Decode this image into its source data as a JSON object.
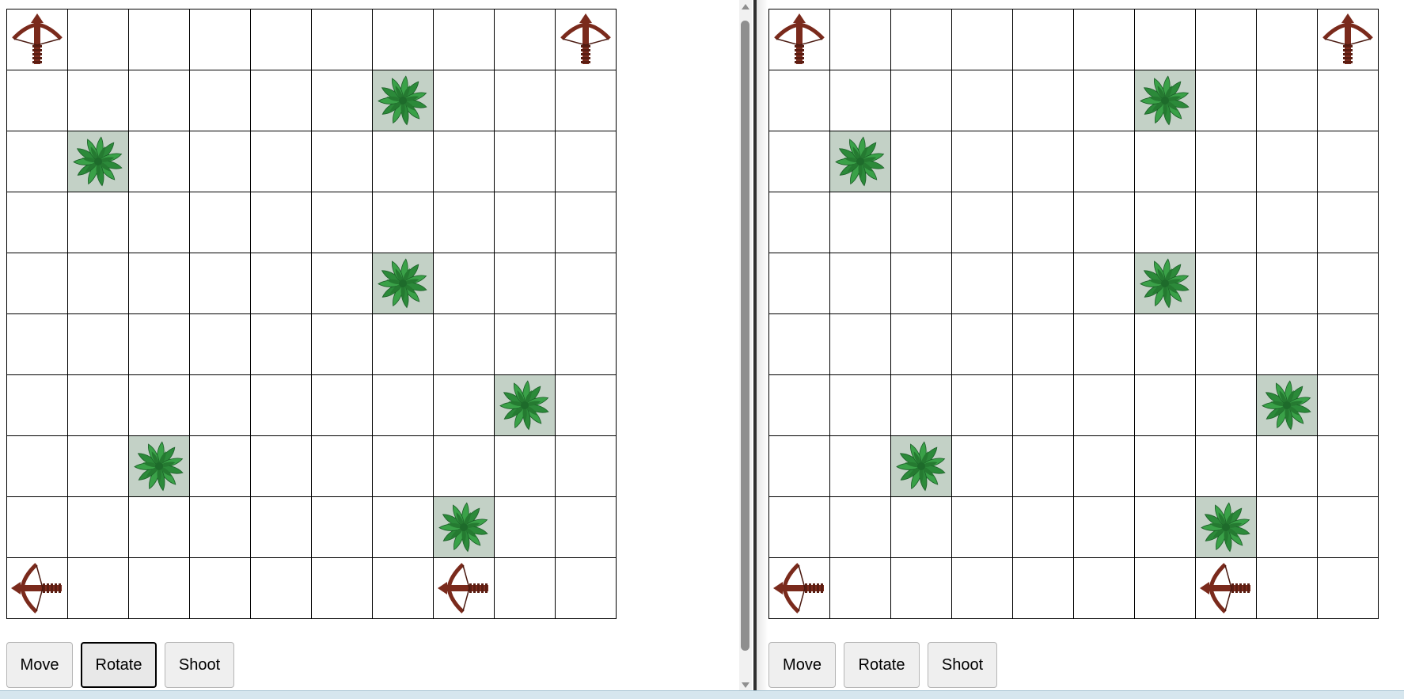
{
  "colors": {
    "grid_line": "#000000",
    "bush_background": "#c3d1c6",
    "bush_leaf": "#2e8b3a",
    "crossbow": "#7a2a1c",
    "button_background": "#efefef"
  },
  "board": {
    "rows": 10,
    "cols": 10,
    "bushes": [
      {
        "row": 1,
        "col": 6
      },
      {
        "row": 2,
        "col": 1
      },
      {
        "row": 4,
        "col": 6
      },
      {
        "row": 6,
        "col": 8
      },
      {
        "row": 7,
        "col": 2
      },
      {
        "row": 8,
        "col": 7
      }
    ],
    "units": [
      {
        "row": 0,
        "col": 0,
        "icon": "crossbow-icon",
        "facing": "up"
      },
      {
        "row": 0,
        "col": 9,
        "icon": "crossbow-icon",
        "facing": "up"
      },
      {
        "row": 9,
        "col": 0,
        "icon": "crossbow-icon",
        "facing": "left"
      },
      {
        "row": 9,
        "col": 7,
        "icon": "crossbow-icon",
        "facing": "left"
      }
    ]
  },
  "left_panel": {
    "controls": {
      "move_label": "Move",
      "rotate_label": "Rotate",
      "shoot_label": "Shoot",
      "focused": "rotate"
    }
  },
  "right_panel": {
    "controls": {
      "move_label": "Move",
      "rotate_label": "Rotate",
      "shoot_label": "Shoot"
    }
  }
}
